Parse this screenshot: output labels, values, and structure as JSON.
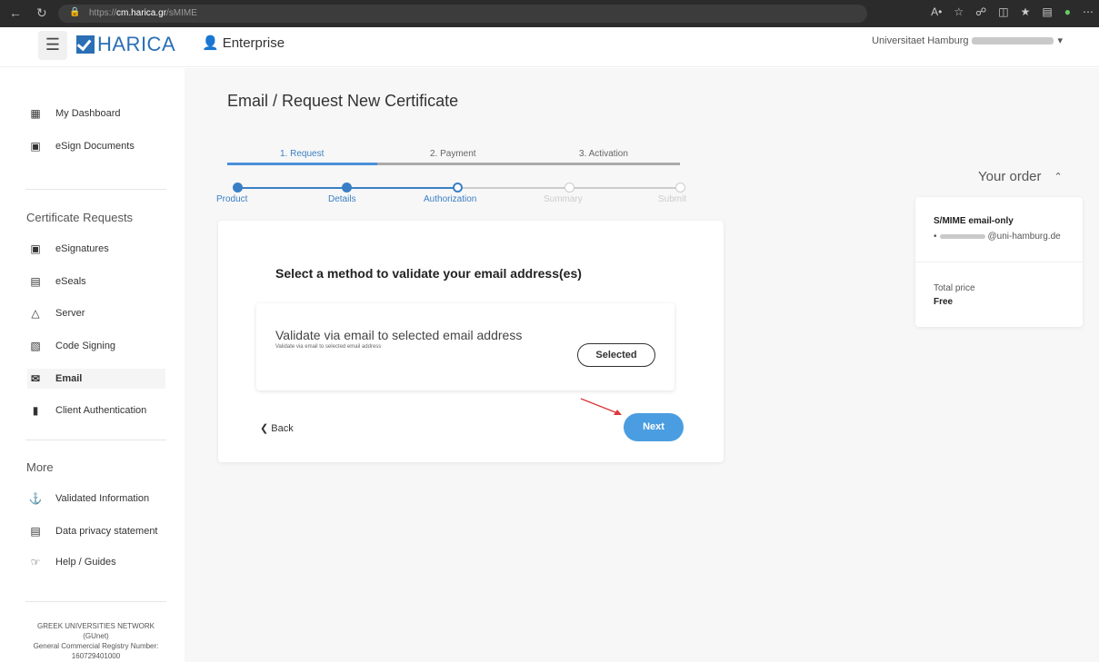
{
  "browser": {
    "url_prefix": "https://",
    "url_domain": "cm.harica.gr",
    "url_path": "/sMIME"
  },
  "header": {
    "menu_icon": "hamburger-icon",
    "logo_text": "HARICA",
    "enterprise_label": "Enterprise",
    "org_label": "Universitaet Hamburg"
  },
  "sidebar": {
    "top_items": [
      {
        "label": "My Dashboard",
        "icon": "dashboard-icon"
      },
      {
        "label": "eSign Documents",
        "icon": "esign-icon"
      }
    ],
    "cert_heading": "Certificate Requests",
    "cert_items": [
      {
        "label": "eSignatures",
        "icon": "esign-icon"
      },
      {
        "label": "eSeals",
        "icon": "seal-icon"
      },
      {
        "label": "Server",
        "icon": "lock-icon"
      },
      {
        "label": "Code Signing",
        "icon": "code-icon"
      },
      {
        "label": "Email",
        "icon": "email-icon"
      },
      {
        "label": "Client Authentication",
        "icon": "client-auth-icon"
      }
    ],
    "more_heading": "More",
    "more_items": [
      {
        "label": "Validated Information",
        "icon": "validated-icon"
      },
      {
        "label": "Data privacy statement",
        "icon": "privacy-icon"
      },
      {
        "label": "Help / Guides",
        "icon": "help-icon"
      }
    ],
    "footer_line1": "GREEK UNIVERSITIES NETWORK",
    "footer_line2": "(GUnet)",
    "footer_line3": "General Commercial Registry Number:",
    "footer_line4": "160729401000"
  },
  "main": {
    "title": "Email / Request New Certificate",
    "tabs": [
      "1. Request",
      "2. Payment",
      "3. Activation"
    ],
    "steps": [
      "Product",
      "Details",
      "Authorization",
      "Summary",
      "Submit"
    ],
    "card_title": "Select a method to validate your email address(es)",
    "option_title": "Validate via email to selected email address",
    "option_subtitle": "Validate via email to selected email address",
    "selected_label": "Selected",
    "back_label": "Back",
    "next_label": "Next"
  },
  "order": {
    "heading": "Your order",
    "product": "S/MIME email-only",
    "email_domain": "@uni-hamburg.de",
    "total_label": "Total price",
    "total_value": "Free"
  },
  "colors": {
    "accent": "#4a9de0",
    "brand": "#2a6fb5"
  }
}
